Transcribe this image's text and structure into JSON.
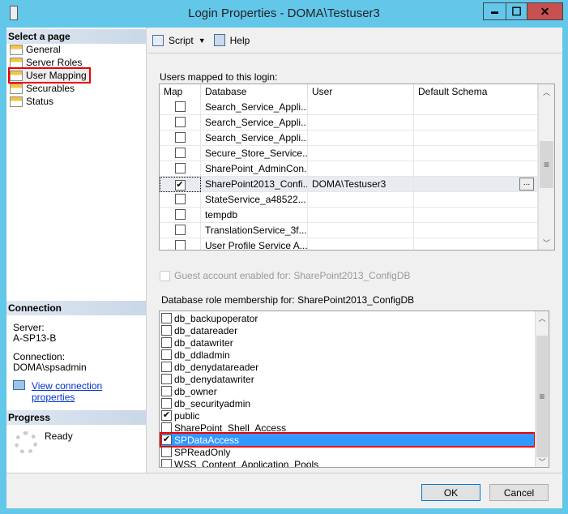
{
  "window": {
    "title": "Login Properties - DOMA\\Testuser3",
    "minimize": "▬",
    "maximize": "☐",
    "close": "✕"
  },
  "sidebar": {
    "header": "Select a page",
    "items": [
      {
        "label": "General"
      },
      {
        "label": "Server Roles"
      },
      {
        "label": "User Mapping"
      },
      {
        "label": "Securables"
      },
      {
        "label": "Status"
      }
    ]
  },
  "connection": {
    "header": "Connection",
    "server_label": "Server:",
    "server": "A-SP13-B",
    "connection_label": "Connection:",
    "connection": "DOMA\\spsadmin",
    "link": "View connection properties"
  },
  "progress": {
    "header": "Progress",
    "status": "Ready"
  },
  "toolbar": {
    "script": "Script",
    "help": "Help"
  },
  "mapping": {
    "label": "Users mapped to this login:",
    "columns": [
      "Map",
      "Database",
      "User",
      "Default Schema"
    ],
    "rows": [
      {
        "checked": false,
        "database": "Search_Service_Appli...",
        "user": "",
        "schema": ""
      },
      {
        "checked": false,
        "database": "Search_Service_Appli...",
        "user": "",
        "schema": ""
      },
      {
        "checked": false,
        "database": "Search_Service_Appli...",
        "user": "",
        "schema": ""
      },
      {
        "checked": false,
        "database": "Secure_Store_Service...",
        "user": "",
        "schema": ""
      },
      {
        "checked": false,
        "database": "SharePoint_AdminCon...",
        "user": "",
        "schema": ""
      },
      {
        "checked": true,
        "database": "SharePoint2013_Confi...",
        "user": "DOMA\\Testuser3",
        "schema": "",
        "browse": "..."
      },
      {
        "checked": false,
        "database": "StateService_a48522...",
        "user": "",
        "schema": ""
      },
      {
        "checked": false,
        "database": "tempdb",
        "user": "",
        "schema": ""
      },
      {
        "checked": false,
        "database": "TranslationService_3f...",
        "user": "",
        "schema": ""
      },
      {
        "checked": false,
        "database": "User Profile Service A...",
        "user": "",
        "schema": ""
      }
    ]
  },
  "guest": {
    "label": "Guest account enabled for: SharePoint2013_ConfigDB",
    "checked": false
  },
  "roles": {
    "label": "Database role membership for: SharePoint2013_ConfigDB",
    "items": [
      {
        "name": "db_backupoperator",
        "checked": false
      },
      {
        "name": "db_datareader",
        "checked": false
      },
      {
        "name": "db_datawriter",
        "checked": false
      },
      {
        "name": "db_ddladmin",
        "checked": false
      },
      {
        "name": "db_denydatareader",
        "checked": false
      },
      {
        "name": "db_denydatawriter",
        "checked": false
      },
      {
        "name": "db_owner",
        "checked": false
      },
      {
        "name": "db_securityadmin",
        "checked": false
      },
      {
        "name": "public",
        "checked": true
      },
      {
        "name": "SharePoint_Shell_Access",
        "checked": false
      },
      {
        "name": "SPDataAccess",
        "checked": true,
        "selected": true
      },
      {
        "name": "SPReadOnly",
        "checked": false
      },
      {
        "name": "WSS_Content_Application_Pools",
        "checked": false
      }
    ]
  },
  "buttons": {
    "ok": "OK",
    "cancel": "Cancel"
  },
  "colors": {
    "frame": "#63c7ea",
    "selection": "#3399ff",
    "highlight_box": "#ff0000",
    "close": "#c75050"
  }
}
